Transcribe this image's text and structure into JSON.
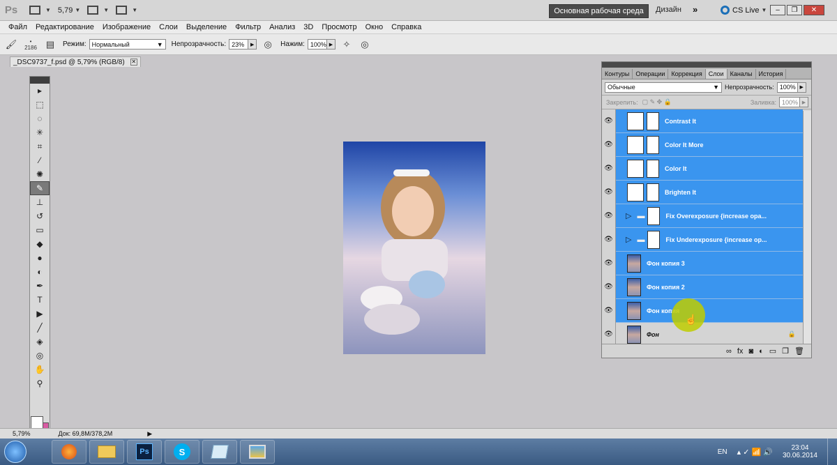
{
  "appbar": {
    "logo": "Ps",
    "zoom": "5,79",
    "workspace": "Основная рабочая среда",
    "design": "Дизайн",
    "more": "»",
    "cslive": "CS Live"
  },
  "menu": [
    "Файл",
    "Редактирование",
    "Изображение",
    "Слои",
    "Выделение",
    "Фильтр",
    "Анализ",
    "3D",
    "Просмотр",
    "Окно",
    "Справка"
  ],
  "options": {
    "brush_size": "2186",
    "mode_label": "Режим:",
    "mode_value": "Нормальный",
    "opacity_label": "Непрозрачность:",
    "opacity_value": "23%",
    "flow_label": "Нажим:",
    "flow_value": "100%"
  },
  "document": {
    "tab_title": "_DSC9737_f.psd @ 5,79% (RGB/8)",
    "zoom": "5,79%",
    "doc_info": "Док: 69,8M/378,2M"
  },
  "layers_panel": {
    "tabs": [
      "Контуры",
      "Операции",
      "Коррекция",
      "Слои",
      "Каналы",
      "История"
    ],
    "active_tab": "Слои",
    "blend_mode": "Обычные",
    "opacity_label": "Непрозрачность:",
    "opacity": "100%",
    "lock_label": "Закрепить:",
    "fill_label": "Заливка:",
    "fill": "100%",
    "layers": [
      {
        "name": "Contrast It",
        "kind": "curves",
        "selected": true
      },
      {
        "name": "Color It More",
        "kind": "levels",
        "selected": true
      },
      {
        "name": "Color It",
        "kind": "color",
        "selected": true
      },
      {
        "name": "Brighten It",
        "kind": "curves",
        "selected": true
      },
      {
        "name": "Fix Overexposure {increase opa...",
        "kind": "group",
        "selected": true
      },
      {
        "name": "Fix Underexposure {increase op...",
        "kind": "group",
        "selected": true
      },
      {
        "name": "Фон копия 3",
        "kind": "photo",
        "selected": true
      },
      {
        "name": "Фон копия 2",
        "kind": "photo",
        "selected": true
      },
      {
        "name": "Фон копия",
        "kind": "photo",
        "selected": true
      },
      {
        "name": "Фон",
        "kind": "background",
        "selected": false
      }
    ]
  },
  "taskbar": {
    "lang": "EN",
    "time": "23:04",
    "date": "30.06.2014"
  }
}
